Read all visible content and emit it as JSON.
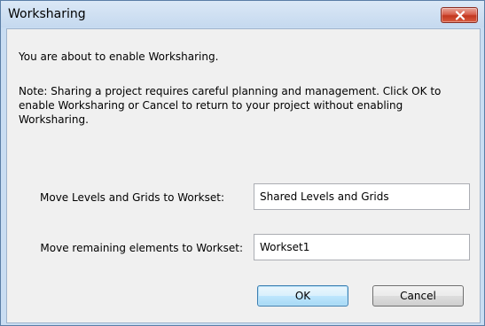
{
  "window": {
    "title": "Worksharing",
    "close_icon": "close-icon"
  },
  "dialog": {
    "intro": "You are about to enable Worksharing.",
    "note": "Note: Sharing a project requires careful planning and management.  Click OK to enable Worksharing or Cancel to return to your project without enabling Worksharing.",
    "levels_label": "Move Levels and Grids to Workset:",
    "levels_value": "Shared Levels and Grids",
    "remaining_label": "Move remaining elements to Workset:",
    "remaining_value": "Workset1",
    "ok_label": "OK",
    "cancel_label": "Cancel"
  },
  "colors": {
    "title_bar": "#c9ddf2",
    "close_button": "#c9402a",
    "default_button_border": "#3c7fb1"
  }
}
